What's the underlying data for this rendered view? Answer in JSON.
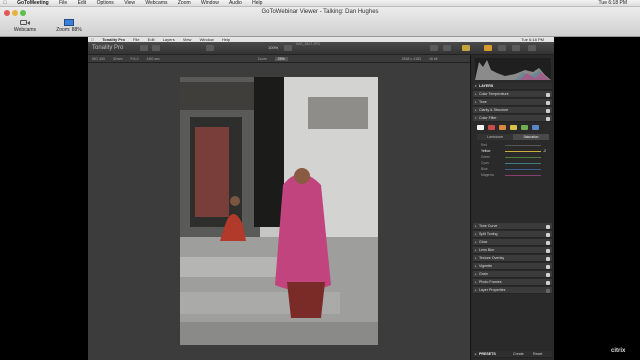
{
  "menubar": {
    "app": "GoToMeeting",
    "items": [
      "File",
      "Edit",
      "Options",
      "View",
      "Webcams",
      "Zoom",
      "Window",
      "Audio",
      "Help"
    ],
    "clock": "Tue 6:18 PM"
  },
  "gtw": {
    "title": "GoToWebinar Viewer - Talking: Dan  Hughes",
    "webcams_label": "Webcams",
    "zoom_label": "Zoom: 88%"
  },
  "tonality": {
    "menu_app": "Tonality Pro",
    "menu_items": [
      "File",
      "Edit",
      "Layers",
      "View",
      "Window",
      "Help"
    ],
    "menu_time": "Tue 6:18 PM",
    "toolbar_name": "Tonality Pro",
    "doc_title": "IMG_3827.JPG",
    "zoom_btn": "100%",
    "info": {
      "iso": "ISO 400",
      "focal": "32mm",
      "aperture": "F/4.0",
      "shutter": "1/60 sec",
      "zoom_label": "Zoom",
      "zoom_value": "25%",
      "dimensions": "2848 x 4183",
      "size": "16 bit"
    }
  },
  "panel": {
    "layers_label": "LAYERS",
    "sections": [
      "Color Temperature",
      "Tone",
      "Clarity & Structure"
    ],
    "color_filter_label": "Color Filter",
    "swatch_colors": [
      "#f2f2f2",
      "#c94b4b",
      "#d98a3e",
      "#d6c24a",
      "#6fae55",
      "#5a86c9"
    ],
    "tabs": [
      "Luminance",
      "Saturation"
    ],
    "channels": [
      "Red",
      "Yellow",
      "Green",
      "Cyan",
      "Blue",
      "Magenta"
    ],
    "yellow_value": "-2",
    "more_sections": [
      "Tone Curve",
      "Split Toning",
      "Glow",
      "Lens Blur",
      "Texture Overlay",
      "Vignette",
      "Grain",
      "Photo Frames",
      "Layer Properties"
    ],
    "presets_label": "PRESETS",
    "create_label": "Create",
    "reset_label": "Reset"
  },
  "watermark": "citrix"
}
